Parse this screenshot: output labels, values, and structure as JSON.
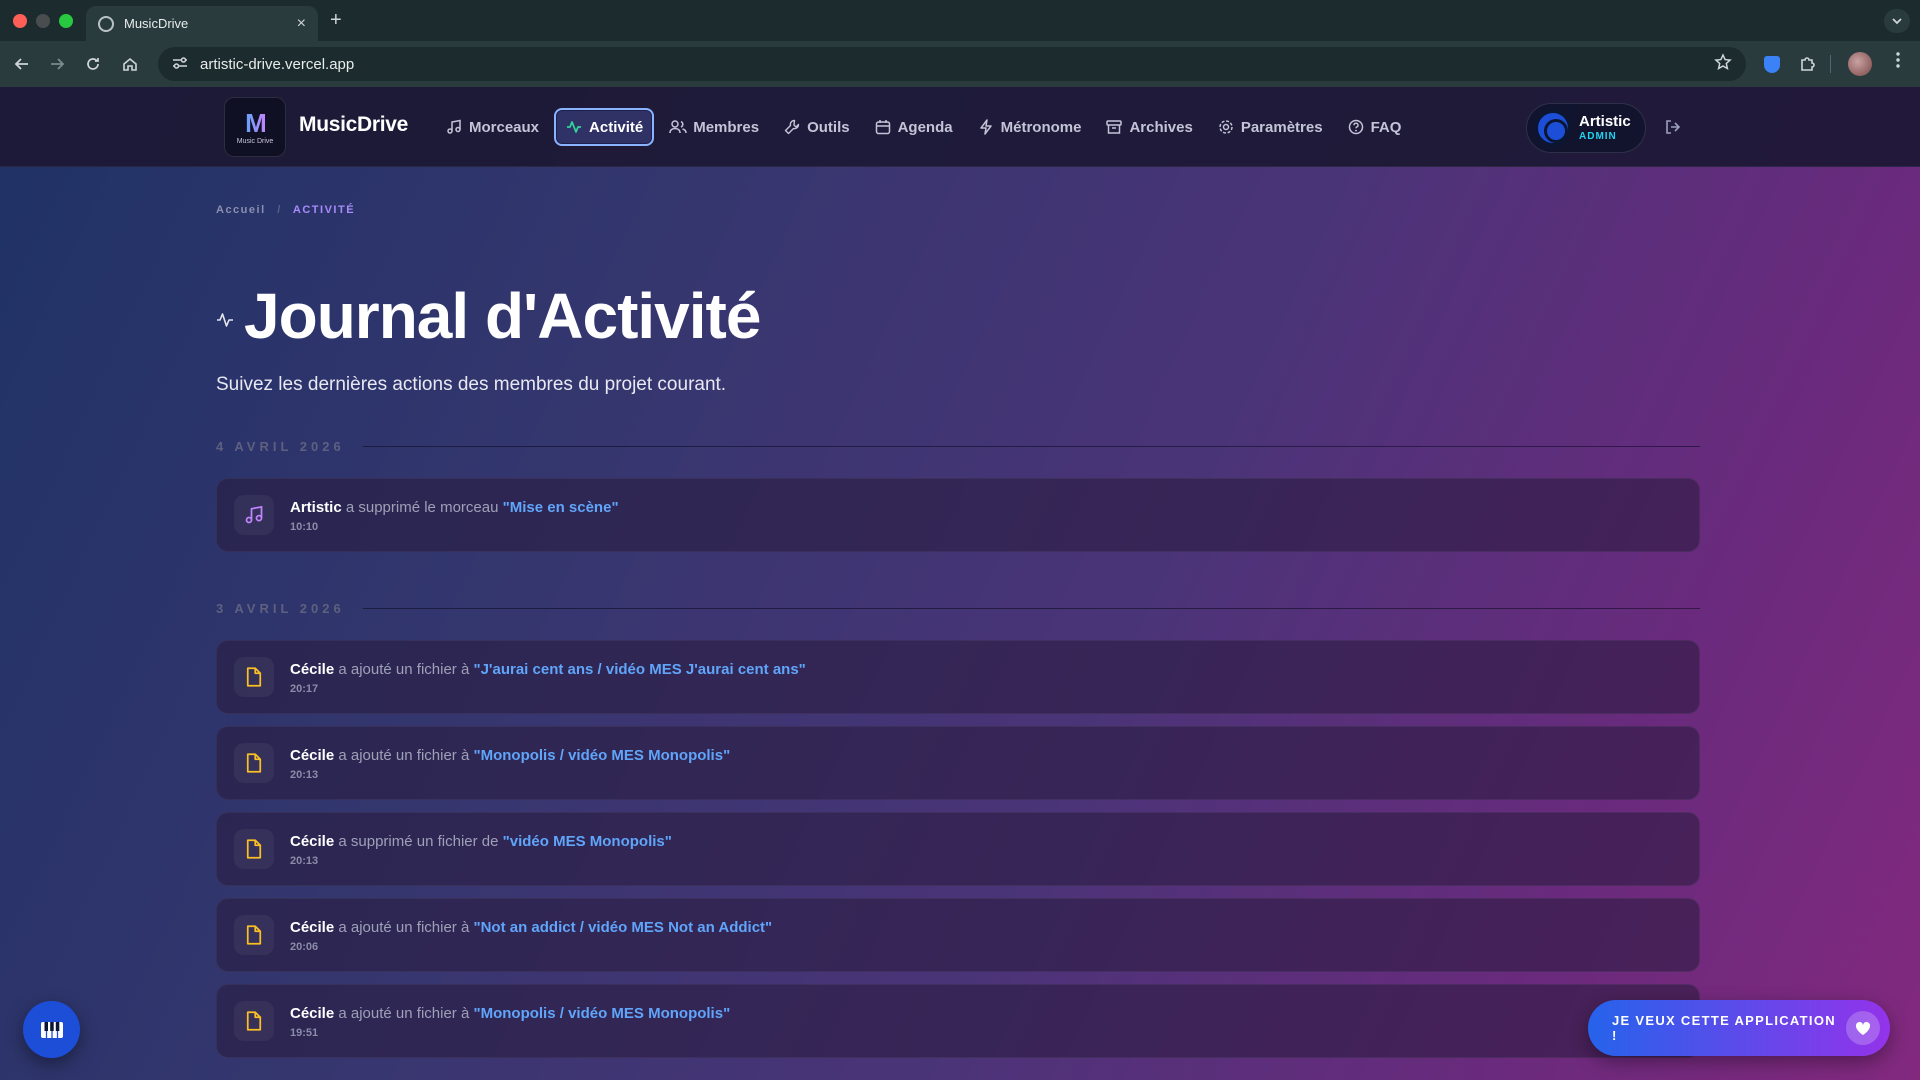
{
  "browser": {
    "tab_title": "MusicDrive",
    "tab_close": "×",
    "new_tab": "+",
    "url": "artistic-drive.vercel.app"
  },
  "app": {
    "brand": "MusicDrive",
    "logo_mark": "M",
    "logo_sub": "Music Drive",
    "nav": [
      {
        "label": "Morceaux",
        "icon": "music-note-icon"
      },
      {
        "label": "Activité",
        "icon": "activity-icon",
        "active": true
      },
      {
        "label": "Membres",
        "icon": "users-icon"
      },
      {
        "label": "Outils",
        "icon": "wrench-icon"
      },
      {
        "label": "Agenda",
        "icon": "calendar-icon"
      },
      {
        "label": "Métronome",
        "icon": "lightning-icon"
      },
      {
        "label": "Archives",
        "icon": "archive-icon"
      },
      {
        "label": "Paramètres",
        "icon": "gear-icon"
      },
      {
        "label": "FAQ",
        "icon": "help-circle-icon"
      }
    ],
    "user": {
      "name": "Artistic",
      "role": "ADMIN"
    }
  },
  "breadcrumb": {
    "home": "Accueil",
    "sep": "/",
    "current": "Activité"
  },
  "page": {
    "title": "Journal d'Activité",
    "subtitle": "Suivez les dernières actions des membres du projet courant."
  },
  "days": [
    {
      "label": "4 avril 2026",
      "entries": [
        {
          "icon": "music-note-icon",
          "user": "Artistic",
          "action": "a supprimé le morceau",
          "target": "\"Mise en scène\"",
          "time": "10:10"
        }
      ]
    },
    {
      "label": "3 avril 2026",
      "entries": [
        {
          "icon": "file-icon",
          "user": "Cécile",
          "action": "a ajouté un fichier à",
          "target": "\"J'aurai cent ans / vidéo MES J'aurai cent ans\"",
          "time": "20:17"
        },
        {
          "icon": "file-icon",
          "user": "Cécile",
          "action": "a ajouté un fichier à",
          "target": "\"Monopolis / vidéo MES Monopolis\"",
          "time": "20:13"
        },
        {
          "icon": "file-icon",
          "user": "Cécile",
          "action": "a supprimé un fichier de",
          "target": "\"vidéo MES Monopolis\"",
          "time": "20:13"
        },
        {
          "icon": "file-icon",
          "user": "Cécile",
          "action": "a ajouté un fichier à",
          "target": "\"Not an addict / vidéo MES Not an Addict\"",
          "time": "20:06"
        },
        {
          "icon": "file-icon",
          "user": "Cécile",
          "action": "a ajouté un fichier à",
          "target": "\"Monopolis / vidéo MES Monopolis\"",
          "time": "19:51"
        }
      ]
    }
  ],
  "cta": {
    "label": "JE VEUX CETTE APPLICATION !"
  },
  "colors": {
    "accent": "#60a5fa",
    "active_icon": "#34d399",
    "file_icon": "#fbbf24",
    "music_icon": "#c084fc",
    "role": "#22d3ee"
  }
}
